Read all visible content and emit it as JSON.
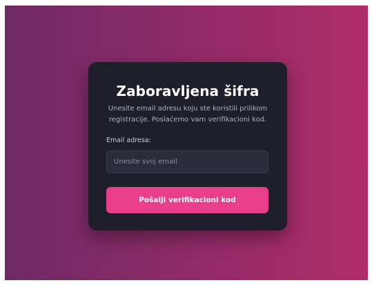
{
  "form": {
    "title": "Zaboravljena šifra",
    "subtitle": "Unesite email adresu koju ste koristili prilikom registracije. Poslaćemo vam verifikacioni kod.",
    "email_label": "Email adresa:",
    "email_placeholder": "Unesite svoj email",
    "email_value": "",
    "submit_label": "Pošalji verifikacioni kod"
  },
  "colors": {
    "background_gradient_start": "#6e2a64",
    "background_gradient_end": "#b02c6b",
    "card_background": "#1f1f2c",
    "input_background": "#2b2c3a",
    "accent": "#e83e8c"
  }
}
